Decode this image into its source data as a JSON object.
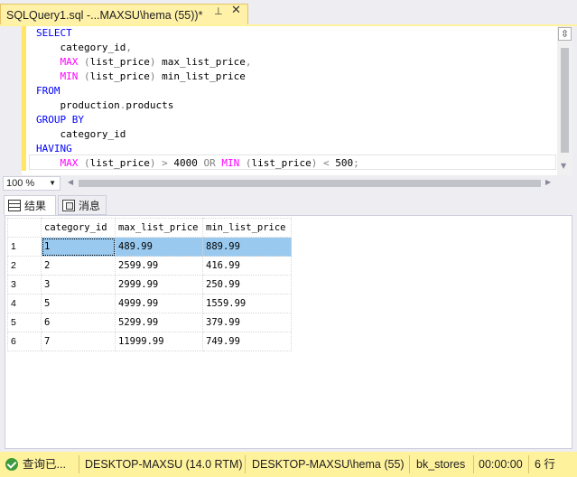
{
  "window": {
    "tab_title": "SQLQuery1.sql -...MAXSU\\hema (55))*",
    "pin_glyph": "⊣",
    "close_glyph": "✕"
  },
  "editor": {
    "lines": [
      [
        {
          "t": "SELECT",
          "c": "kw"
        }
      ],
      [
        {
          "t": "    category_id",
          "c": ""
        },
        {
          "t": ",",
          "c": "op"
        }
      ],
      [
        {
          "t": "    ",
          "c": ""
        },
        {
          "t": "MAX",
          "c": "fn"
        },
        {
          "t": " ",
          "c": ""
        },
        {
          "t": "(",
          "c": "op"
        },
        {
          "t": "list_price",
          "c": ""
        },
        {
          "t": ")",
          "c": "op"
        },
        {
          "t": " max_list_price",
          "c": ""
        },
        {
          "t": ",",
          "c": "op"
        }
      ],
      [
        {
          "t": "    ",
          "c": ""
        },
        {
          "t": "MIN",
          "c": "fn"
        },
        {
          "t": " ",
          "c": ""
        },
        {
          "t": "(",
          "c": "op"
        },
        {
          "t": "list_price",
          "c": ""
        },
        {
          "t": ")",
          "c": "op"
        },
        {
          "t": " min_list_price",
          "c": ""
        }
      ],
      [
        {
          "t": "FROM",
          "c": "kw"
        }
      ],
      [
        {
          "t": "    production",
          "c": ""
        },
        {
          "t": ".",
          "c": "op"
        },
        {
          "t": "products",
          "c": ""
        }
      ],
      [
        {
          "t": "GROUP BY",
          "c": "kw"
        }
      ],
      [
        {
          "t": "    category_id",
          "c": ""
        }
      ],
      [
        {
          "t": "HAVING",
          "c": "kw"
        }
      ],
      [
        {
          "t": "    ",
          "c": ""
        },
        {
          "t": "MAX",
          "c": "fn"
        },
        {
          "t": " ",
          "c": ""
        },
        {
          "t": "(",
          "c": "op"
        },
        {
          "t": "list_price",
          "c": ""
        },
        {
          "t": ")",
          "c": "op"
        },
        {
          "t": " ",
          "c": ""
        },
        {
          "t": ">",
          "c": "op"
        },
        {
          "t": " 4000 ",
          "c": ""
        },
        {
          "t": "OR",
          "c": "op"
        },
        {
          "t": " ",
          "c": ""
        },
        {
          "t": "MIN",
          "c": "fn"
        },
        {
          "t": " ",
          "c": ""
        },
        {
          "t": "(",
          "c": "op"
        },
        {
          "t": "list_price",
          "c": ""
        },
        {
          "t": ")",
          "c": "op"
        },
        {
          "t": " ",
          "c": ""
        },
        {
          "t": "<",
          "c": "op"
        },
        {
          "t": " 500",
          "c": ""
        },
        {
          "t": ";",
          "c": "op"
        }
      ]
    ]
  },
  "zoom": {
    "value": "100 %"
  },
  "result_tabs": {
    "results": "结果",
    "messages": "消息"
  },
  "grid": {
    "columns": [
      "category_id",
      "max_list_price",
      "min_list_price"
    ],
    "rows": [
      {
        "num": "1",
        "cells": [
          "1",
          "489.99",
          "889.99"
        ]
      },
      {
        "num": "2",
        "cells": [
          "2",
          "2599.99",
          "416.99"
        ]
      },
      {
        "num": "3",
        "cells": [
          "3",
          "2999.99",
          "250.99"
        ]
      },
      {
        "num": "4",
        "cells": [
          "5",
          "4999.99",
          "1559.99"
        ]
      },
      {
        "num": "5",
        "cells": [
          "6",
          "5299.99",
          "379.99"
        ]
      },
      {
        "num": "6",
        "cells": [
          "7",
          "11999.99",
          "749.99"
        ]
      }
    ],
    "selected_row": 0
  },
  "status": {
    "query_state": "查询已...",
    "server": "DESKTOP-MAXSU (14.0 RTM)",
    "login": "DESKTOP-MAXSU\\hema (55)",
    "database": "bk_stores",
    "elapsed": "00:00:00",
    "row_count": "6 行"
  },
  "colors": {
    "tab_active": "#fff1a8",
    "status_bar": "#fff29d",
    "keyword": "#0000ff",
    "function": "#ff00ff",
    "operator": "#808080",
    "row_selected": "#99c9ef"
  }
}
